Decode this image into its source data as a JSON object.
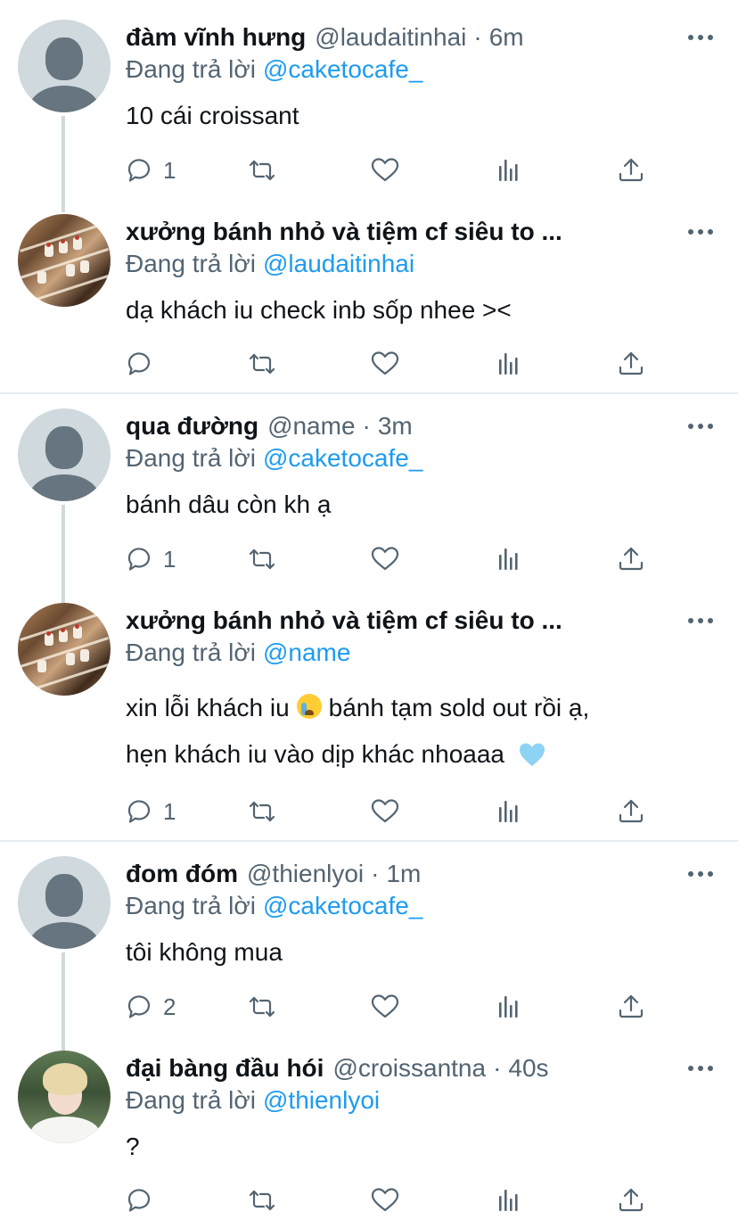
{
  "reply_prefix": "Đang trả lời",
  "tweets": [
    {
      "name": "đàm vĩnh hưng",
      "handle": "@laudaitinhai",
      "time": "6m",
      "reply_to": "@caketocafe_",
      "text": "10 cái croissant",
      "reply_count": "1",
      "avatar": "default-avatar"
    },
    {
      "name": "xưởng bánh nhỏ và tiệm cf siêu to ...",
      "reply_to": "@laudaitinhai",
      "text": "dạ khách iu check inb sốp nhee ><",
      "reply_count": "",
      "avatar": "bakery-avatar"
    },
    {
      "name": "qua đường",
      "handle": "@name",
      "time": "3m",
      "reply_to": "@caketocafe_",
      "text": "bánh dâu còn kh ạ",
      "reply_count": "1",
      "avatar": "default-avatar"
    },
    {
      "name": "xưởng bánh nhỏ và tiệm cf siêu to ...",
      "reply_to": "@name",
      "text_line1_a": "xin lỗi khách iu",
      "text_line1_b": "bánh tạm sold out rồi ạ,",
      "text_line2": "hẹn khách iu vào dịp khác nhoaaa",
      "reply_count": "1",
      "avatar": "bakery-avatar",
      "emojis": [
        "loudly-crying-face-emoji",
        "light-blue-heart-emoji"
      ]
    },
    {
      "name": "đom đóm",
      "handle": "@thienlyoi",
      "time": "1m",
      "reply_to": "@caketocafe_",
      "text": "tôi không mua",
      "reply_count": "2",
      "avatar": "default-avatar"
    },
    {
      "name": "đại bàng đầu hói",
      "handle": "@croissantna",
      "time": "40s",
      "reply_to": "@thienlyoi",
      "text": "?",
      "reply_count": "",
      "avatar": "person-avatar"
    }
  ],
  "icons": [
    "reply-icon",
    "retweet-icon",
    "like-icon",
    "analytics-icon",
    "share-icon",
    "more-icon"
  ],
  "colors": {
    "mention": "#1d9bf0",
    "secondary_text": "#536471",
    "primary_text": "#0f1419",
    "thread_line": "#cfd9de",
    "divider": "#e6ecf0"
  }
}
